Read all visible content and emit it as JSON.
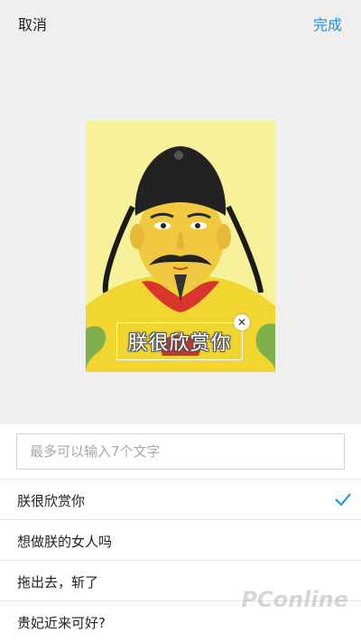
{
  "header": {
    "cancel_label": "取消",
    "done_label": "完成",
    "done_color": "#1a8fe8"
  },
  "sticker": {
    "caption": "朕很欣赏你",
    "close_icon": "close-icon",
    "background_color": "#f7f199"
  },
  "input": {
    "value": "",
    "placeholder": "最多可以输入7个文字"
  },
  "options": [
    {
      "label": "朕很欣赏你",
      "selected": true
    },
    {
      "label": "想做朕的女人吗",
      "selected": false
    },
    {
      "label": "拖出去，斩了",
      "selected": false
    },
    {
      "label": "贵妃近来可好?",
      "selected": false
    }
  ],
  "watermark": "PConline"
}
